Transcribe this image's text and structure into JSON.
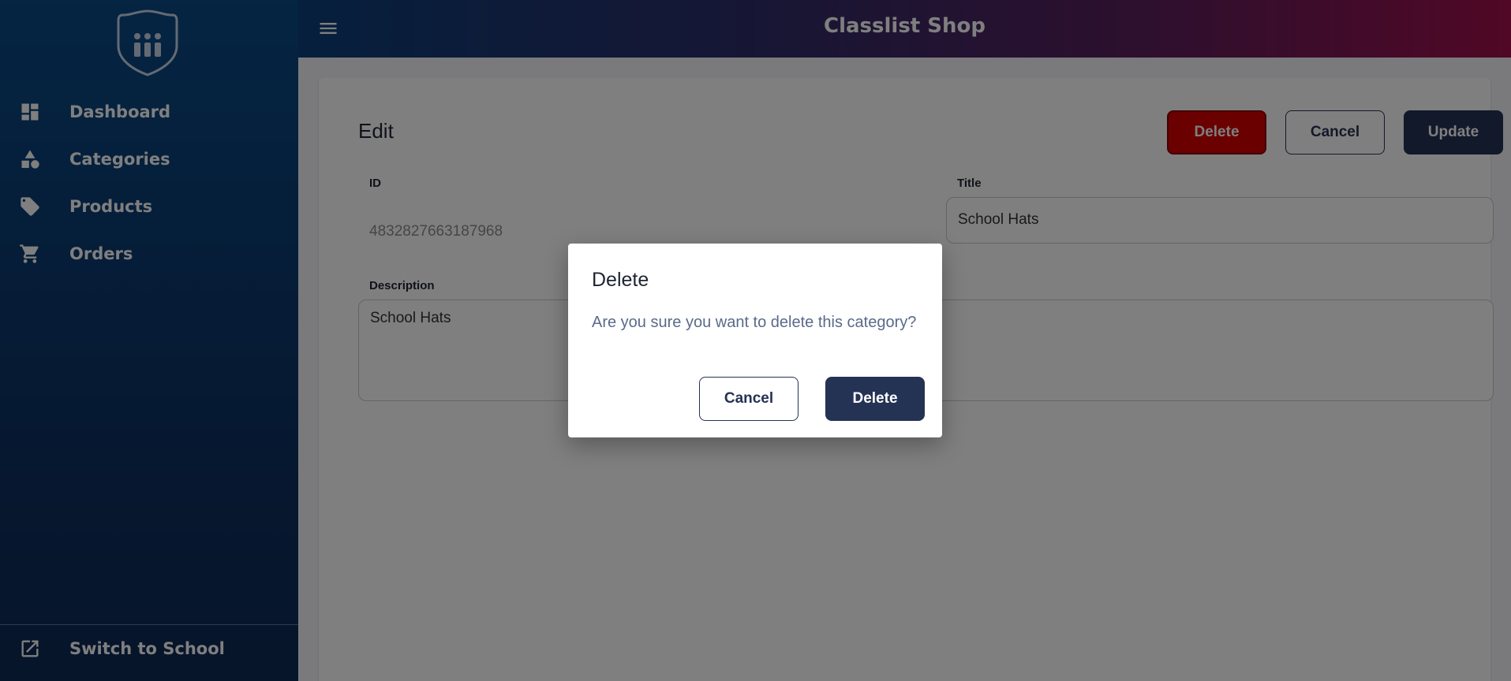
{
  "app": {
    "title": "Classlist Shop"
  },
  "sidebar": {
    "items": [
      {
        "label": "Dashboard",
        "icon": "dashboard-icon"
      },
      {
        "label": "Categories",
        "icon": "categories-icon"
      },
      {
        "label": "Products",
        "icon": "tag-icon"
      },
      {
        "label": "Orders",
        "icon": "cart-icon"
      }
    ],
    "footer": {
      "label": "Switch to School",
      "icon": "external-link-icon"
    }
  },
  "page": {
    "title": "Edit",
    "buttons": {
      "delete": "Delete",
      "cancel": "Cancel",
      "update": "Update"
    },
    "fields": {
      "id": {
        "label": "ID",
        "value": "4832827663187968"
      },
      "title": {
        "label": "Title",
        "value": "School Hats"
      },
      "description": {
        "label": "Description",
        "value": "School Hats"
      }
    }
  },
  "dialog": {
    "title": "Delete",
    "message": "Are you sure you want to delete this category?",
    "cancel_label": "Cancel",
    "delete_label": "Delete"
  },
  "colors": {
    "sidebar": "#0b3c72",
    "delete_red": "#d40000",
    "primary_navy": "#243254",
    "overlay": "rgba(0,0,0,0.5)"
  }
}
